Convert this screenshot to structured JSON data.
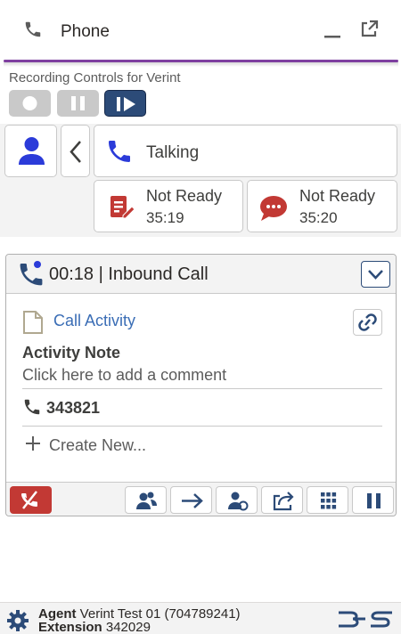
{
  "header": {
    "title": "Phone",
    "phone_icon": "phone-icon",
    "minimize_icon": "minimize-icon",
    "popout_icon": "popout-icon",
    "accent_color": "#7e3fa0"
  },
  "verint": {
    "label": "Recording Controls for Verint",
    "record_icon": "record-icon",
    "pause_icon": "pause-icon",
    "resume_icon": "resume-recording-icon",
    "active_color": "#2c4b78",
    "disabled_color": "#c9c9c9"
  },
  "status": {
    "agent_icon": "agent-icon",
    "back_icon": "chevron-left-icon",
    "talking_label": "Talking",
    "talking_icon": "phone-icon",
    "not_ready": [
      {
        "label": "Not Ready",
        "time": "35:19",
        "icon": "note-edit-icon"
      },
      {
        "label": "Not Ready",
        "time": "35:20",
        "icon": "chat-bubble-icon"
      }
    ],
    "icon_blue": "#2b3bd9",
    "icon_red": "#c23934"
  },
  "call": {
    "timer": "00:18",
    "separator": " | ",
    "type": "Inbound Call",
    "activity_link": "Call Activity",
    "note_label": "Activity Note",
    "comment_placeholder": "Click here to add a comment",
    "phone_number": "343821",
    "create_new": "Create New...",
    "toolbar": [
      "end-call-icon",
      "conference-icon",
      "transfer-arrow-icon",
      "consult-icon",
      "share-icon",
      "dialpad-icon",
      "hold-icon"
    ]
  },
  "footer": {
    "agent_label": "Agent",
    "agent_value": "Verint Test 01 (704789241)",
    "extension_label": "Extension",
    "extension_value": "342029",
    "gear_icon": "gear-icon",
    "brand_icon": "bucher-suter-logo-icon"
  }
}
